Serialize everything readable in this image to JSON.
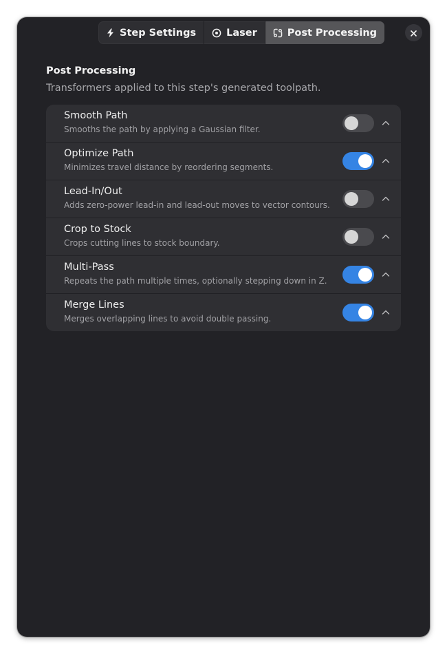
{
  "tabs": [
    {
      "label": "Step Settings",
      "icon": "bolt-icon",
      "active": false
    },
    {
      "label": "Laser",
      "icon": "target-icon",
      "active": false
    },
    {
      "label": "Post Processing",
      "icon": "transform-icon",
      "active": true
    }
  ],
  "header": {
    "close_icon": "close-icon"
  },
  "section": {
    "title": "Post Processing",
    "description": "Transformers applied to this step's generated toolpath."
  },
  "items": [
    {
      "title": "Smooth Path",
      "subtitle": "Smooths the path by applying a Gaussian filter.",
      "enabled": false
    },
    {
      "title": "Optimize Path",
      "subtitle": "Minimizes travel distance by reordering segments.",
      "enabled": true
    },
    {
      "title": "Lead-In/Out",
      "subtitle": "Adds zero-power lead-in and lead-out moves to vector contours.",
      "enabled": false
    },
    {
      "title": "Crop to Stock",
      "subtitle": "Crops cutting lines to stock boundary.",
      "enabled": false
    },
    {
      "title": "Multi-Pass",
      "subtitle": "Repeats the path multiple times, optionally stepping down in Z.",
      "enabled": true
    },
    {
      "title": "Merge Lines",
      "subtitle": "Merges overlapping lines to avoid double passing.",
      "enabled": true
    }
  ],
  "colors": {
    "accent": "#3584e4",
    "window_bg": "#222226",
    "card_bg": "#2f2f33"
  }
}
